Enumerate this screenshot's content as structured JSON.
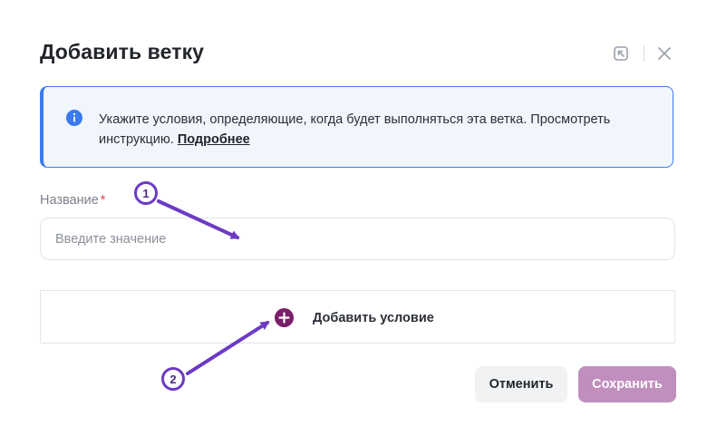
{
  "dialog": {
    "title": "Добавить ветку",
    "header_icons": [
      "collapse-arrow-icon",
      "close-icon"
    ]
  },
  "info": {
    "text": "Укажите условия, определяющие, когда будет выполняться эта ветка. Просмотреть инструкцию.",
    "link": "Подробнее"
  },
  "form": {
    "name_label": "Название",
    "required_mark": "*",
    "name_placeholder": "Введите значение",
    "name_value": ""
  },
  "conditions": {
    "add_label": "Добавить условие"
  },
  "buttons": {
    "cancel": "Отменить",
    "save": "Сохранить"
  },
  "annotations": [
    {
      "number": "1"
    },
    {
      "number": "2"
    }
  ],
  "colors": {
    "accent": "#3b7bec",
    "info_bg": "#f1f6fd",
    "add_icon": "#7a1f6b",
    "save_button": "#c08fbe",
    "annotation": "#6c3bc4",
    "required": "#e5484d"
  }
}
